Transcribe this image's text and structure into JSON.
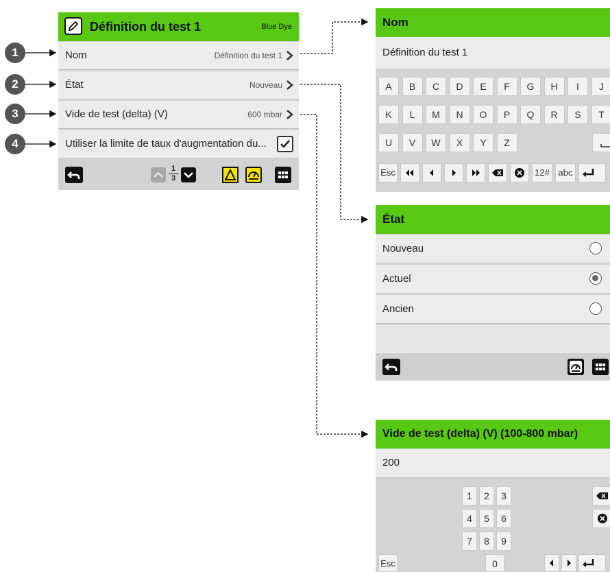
{
  "left_panel": {
    "title": "Définition du test 1",
    "subtitle": "Blue Dye",
    "rows": [
      {
        "label": "Nom",
        "value": "Définition du test 1"
      },
      {
        "label": "État",
        "value": "Nouveau"
      },
      {
        "label": "Vide de test (delta) (V)",
        "value": "600 mbar"
      },
      {
        "label": "Utiliser la limite de taux d'augmentation du...",
        "value": ""
      }
    ],
    "page_num": "1",
    "page_den": "3",
    "checkbox_checked": true,
    "accent_color": "#58c814",
    "warning_color": "#f5e400"
  },
  "callouts": [
    "1",
    "2",
    "3",
    "4"
  ],
  "nom_panel": {
    "title": "Nom",
    "input_value": "Définition du test 1",
    "row1": [
      "A",
      "B",
      "C",
      "D",
      "E",
      "F",
      "G",
      "H",
      "I",
      "J"
    ],
    "row2": [
      "K",
      "L",
      "M",
      "N",
      "O",
      "P",
      "Q",
      "R",
      "S",
      "T"
    ],
    "row3": [
      "U",
      "V",
      "W",
      "X",
      "Y",
      "Z"
    ],
    "esc": "Esc",
    "sym": "12#",
    "abc": "abc"
  },
  "etat_panel": {
    "title": "État",
    "options": [
      {
        "label": "Nouveau",
        "selected": false
      },
      {
        "label": "Actuel",
        "selected": true
      },
      {
        "label": "Ancien",
        "selected": false
      }
    ]
  },
  "vide_panel": {
    "title": "Vide de test (delta) (V) (100-800 mbar)",
    "input_value": "200",
    "keys": [
      "1",
      "2",
      "3",
      "4",
      "5",
      "6",
      "7",
      "8",
      "9",
      "0"
    ],
    "esc": "Esc"
  }
}
